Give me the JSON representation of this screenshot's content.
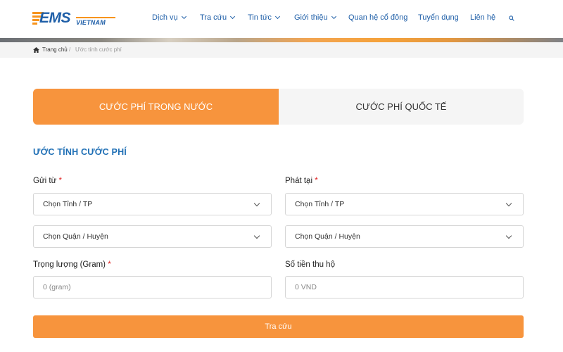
{
  "brand": {
    "logo_main": "EMS",
    "logo_sub": "VIETNAM",
    "accent": "#f7943d",
    "primary": "#1f5fa8"
  },
  "nav": {
    "items": [
      {
        "label": "Dịch vụ",
        "dropdown": true
      },
      {
        "label": "Tra cứu",
        "dropdown": true
      },
      {
        "label": "Tin tức",
        "dropdown": true
      },
      {
        "label": "Giới thiệu",
        "dropdown": true
      },
      {
        "label": "Quan hệ cổ đông",
        "dropdown": false
      },
      {
        "label": "Tuyển dụng",
        "dropdown": false
      },
      {
        "label": "Liên hệ",
        "dropdown": false
      }
    ],
    "search_icon": "search-icon"
  },
  "breadcrumb": {
    "home": "Trang chủ",
    "separator": "/",
    "current": "Ước tính cước phí"
  },
  "tabs": [
    {
      "label": "CƯỚC PHÍ TRONG NƯỚC",
      "active": true
    },
    {
      "label": "CƯỚC PHÍ QUỐC TẾ",
      "active": false
    }
  ],
  "form": {
    "title": "ƯỚC TÍNH CƯỚC PHÍ",
    "from": {
      "label": "Gửi từ",
      "required_mark": "*",
      "province_value": "Chọn Tỉnh / TP",
      "district_value": "Chọn Quận / Huyện"
    },
    "to": {
      "label": "Phát tại",
      "required_mark": "*",
      "province_value": "Chọn Tỉnh / TP",
      "district_value": "Chọn Quận / Huyện"
    },
    "weight": {
      "label": "Trọng lượng (Gram)",
      "required_mark": "*",
      "value": "",
      "placeholder": "0 (gram)"
    },
    "cod": {
      "label": "Số tiền thu hộ",
      "value": "",
      "placeholder": "0 VND"
    },
    "submit_label": "Tra cứu"
  }
}
